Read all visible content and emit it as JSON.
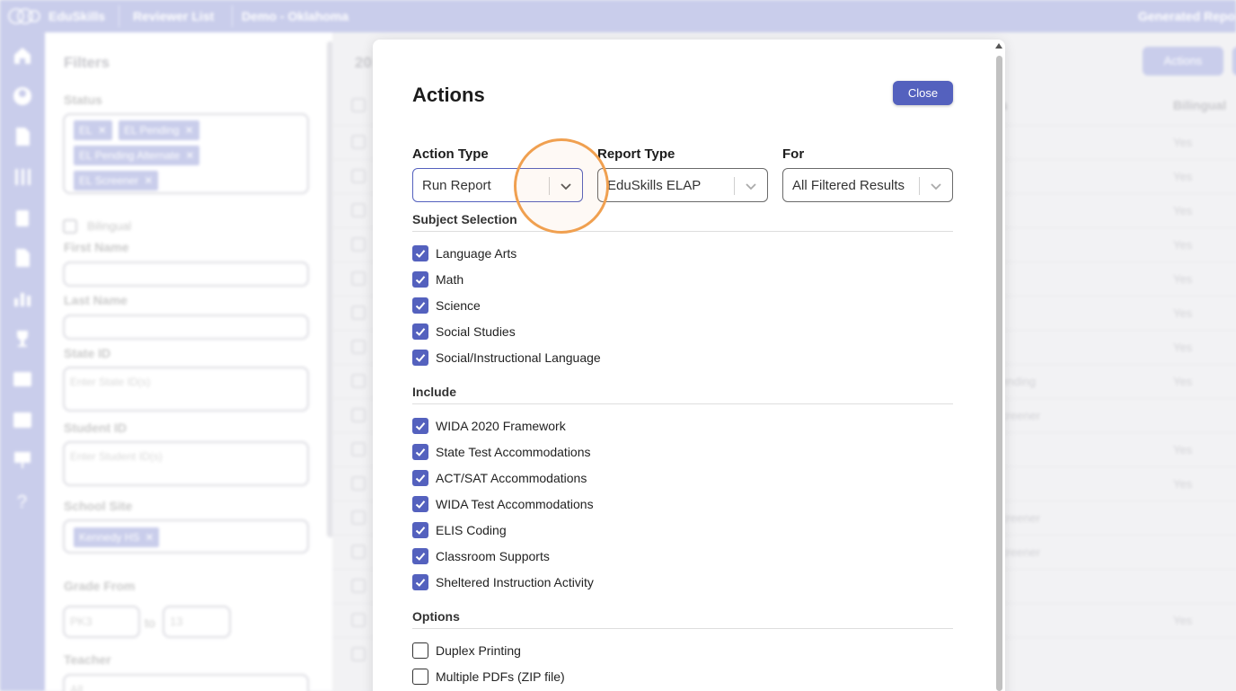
{
  "topbar": {
    "brand": "EduSkills",
    "reviewer_list": "Reviewer List",
    "district": "Demo - Oklahoma",
    "generated_reports": "Generated Repo"
  },
  "filters": {
    "title": "Filters",
    "status_label": "Status",
    "status_chips": [
      "EL",
      "EL Pending",
      "EL Pending Alternate",
      "EL Screener"
    ],
    "bilingual_label": "Bilingual",
    "first_name_label": "First Name",
    "last_name_label": "Last Name",
    "state_id_label": "State ID",
    "state_id_placeholder": "Enter State ID(s)",
    "student_id_label": "Student ID",
    "student_id_placeholder": "Enter Student ID(s)",
    "school_site_label": "School Site",
    "school_chip": "Kennedy HS",
    "grade_from_label": "Grade From",
    "grade_from": "PK3",
    "grade_to_word": "to",
    "grade_to": "13",
    "teacher_label": "Teacher",
    "teacher_value": "All"
  },
  "table": {
    "count_prefix": "20",
    "actions_button": "Actions",
    "col_status_fragment": "s",
    "col_bilingual": "Bilingual",
    "rows": [
      {
        "status": "",
        "bilingual": "Yes"
      },
      {
        "status": "",
        "bilingual": "Yes"
      },
      {
        "status": "",
        "bilingual": "Yes"
      },
      {
        "status": "",
        "bilingual": "Yes"
      },
      {
        "status": "",
        "bilingual": "Yes"
      },
      {
        "status": "",
        "bilingual": "Yes"
      },
      {
        "status": "",
        "bilingual": "Yes"
      },
      {
        "status": "ending",
        "bilingual": "Yes"
      },
      {
        "status": "creener",
        "bilingual": ""
      },
      {
        "status": "",
        "bilingual": "Yes"
      },
      {
        "status": "",
        "bilingual": "Yes"
      },
      {
        "status": "creener",
        "bilingual": ""
      },
      {
        "status": "creener",
        "bilingual": ""
      },
      {
        "status": "",
        "bilingual": ""
      },
      {
        "status": "",
        "bilingual": "Yes"
      },
      {
        "status": "",
        "bilingual": ""
      }
    ]
  },
  "modal": {
    "title": "Actions",
    "close": "Close",
    "action_type_label": "Action Type",
    "action_type_value": "Run Report",
    "report_type_label": "Report Type",
    "report_type_value": "EduSkills ELAP",
    "for_label": "For",
    "for_value": "All Filtered Results",
    "subject_title": "Subject Selection",
    "subjects": [
      {
        "label": "Language Arts",
        "checked": true
      },
      {
        "label": "Math",
        "checked": true
      },
      {
        "label": "Science",
        "checked": true
      },
      {
        "label": "Social Studies",
        "checked": true
      },
      {
        "label": "Social/Instructional Language",
        "checked": true
      }
    ],
    "include_title": "Include",
    "includes": [
      {
        "label": "WIDA 2020 Framework",
        "checked": true
      },
      {
        "label": "State Test Accommodations",
        "checked": true
      },
      {
        "label": "ACT/SAT Accommodations",
        "checked": true
      },
      {
        "label": "WIDA Test Accommodations",
        "checked": true
      },
      {
        "label": "ELIS Coding",
        "checked": true
      },
      {
        "label": "Classroom Supports",
        "checked": true
      },
      {
        "label": "Sheltered Instruction Activity",
        "checked": true
      }
    ],
    "options_title": "Options",
    "options": [
      {
        "label": "Duplex Printing",
        "checked": false
      },
      {
        "label": "Multiple PDFs (ZIP file)",
        "checked": false
      }
    ]
  },
  "colors": {
    "accent": "#5461be",
    "rail": "#c9cdeb",
    "cursor_ring": "#f0a050"
  }
}
